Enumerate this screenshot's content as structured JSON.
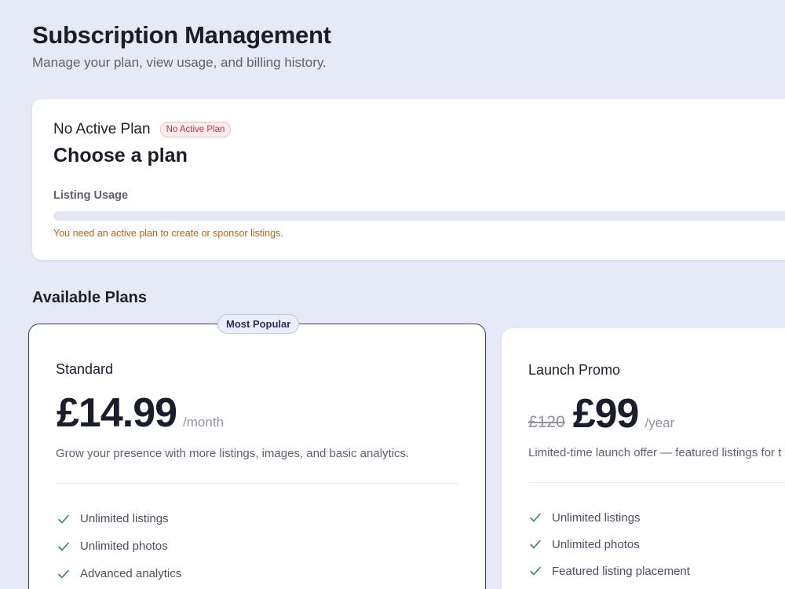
{
  "header": {
    "title": "Subscription Management",
    "subtitle": "Manage your plan, view usage, and billing history."
  },
  "status": {
    "label": "No Active Plan",
    "badge": "No Active Plan",
    "heading": "Choose a plan",
    "usage_label": "Listing Usage",
    "usage_fraction": 0,
    "warning": "You need an active plan to create or sponsor listings."
  },
  "plans_section": {
    "title": "Available Plans",
    "plans": [
      {
        "badge": "Most Popular",
        "name": "Standard",
        "old_price": "",
        "price": "£14.99",
        "period": "/month",
        "description": "Grow your presence with more listings, images, and basic analytics.",
        "features": [
          "Unlimited listings",
          "Unlimited photos",
          "Advanced analytics"
        ]
      },
      {
        "name": "Launch Promo",
        "old_price": "£120",
        "price": "£99",
        "period": "/year",
        "description": "Limited-time launch offer — featured listings for t",
        "features": [
          "Unlimited listings",
          "Unlimited photos",
          "Featured listing placement"
        ]
      }
    ]
  },
  "colors": {
    "background": "#e6eaf6",
    "accent": "#3c3f72",
    "danger": "#c3343c",
    "warning": "#b8621b",
    "check": "#2f8a57"
  }
}
